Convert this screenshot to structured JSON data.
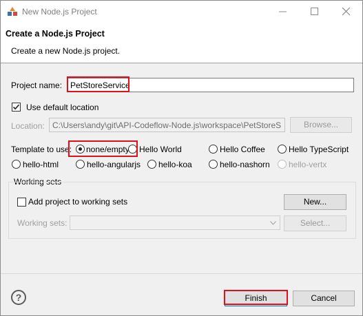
{
  "window": {
    "title": "New Node.js Project",
    "icon": "eclipse-node-project-icon"
  },
  "header": {
    "title": "Create a Node.js Project",
    "subtitle": "Create a new Node.js project."
  },
  "project_name": {
    "label": "Project name:",
    "value": "PetStoreService"
  },
  "location": {
    "use_default_label": "Use default location",
    "use_default_checked": true,
    "label": "Location:",
    "value": "C:\\Users\\andy\\git\\API-Codeflow-Node.js\\workspace\\PetStoreS",
    "browse_label": "Browse..."
  },
  "template": {
    "label": "Template to use:",
    "selected": "none/empty",
    "options": [
      {
        "label": "none/empty",
        "selected": true,
        "enabled": true
      },
      {
        "label": "Hello World",
        "selected": false,
        "enabled": true
      },
      {
        "label": "Hello Coffee",
        "selected": false,
        "enabled": true
      },
      {
        "label": "Hello TypeScript",
        "selected": false,
        "enabled": true
      },
      {
        "label": "hello-html",
        "selected": false,
        "enabled": true
      },
      {
        "label": "hello-angularjs",
        "selected": false,
        "enabled": true
      },
      {
        "label": "hello-koa",
        "selected": false,
        "enabled": true
      },
      {
        "label": "hello-nashorn",
        "selected": false,
        "enabled": true
      },
      {
        "label": "hello-vertx",
        "selected": false,
        "enabled": false
      }
    ]
  },
  "working_sets": {
    "group_label": "Working sets",
    "add_label": "Add project to working sets",
    "add_checked": false,
    "new_label": "New...",
    "sets_label": "Working sets:",
    "sets_value": "",
    "select_label": "Select..."
  },
  "footer": {
    "help_label": "?",
    "finish_label": "Finish",
    "cancel_label": "Cancel"
  },
  "colors": {
    "highlight": "#e0101a",
    "window_bg": "#f0f0f0",
    "header_bg": "#ffffff"
  }
}
